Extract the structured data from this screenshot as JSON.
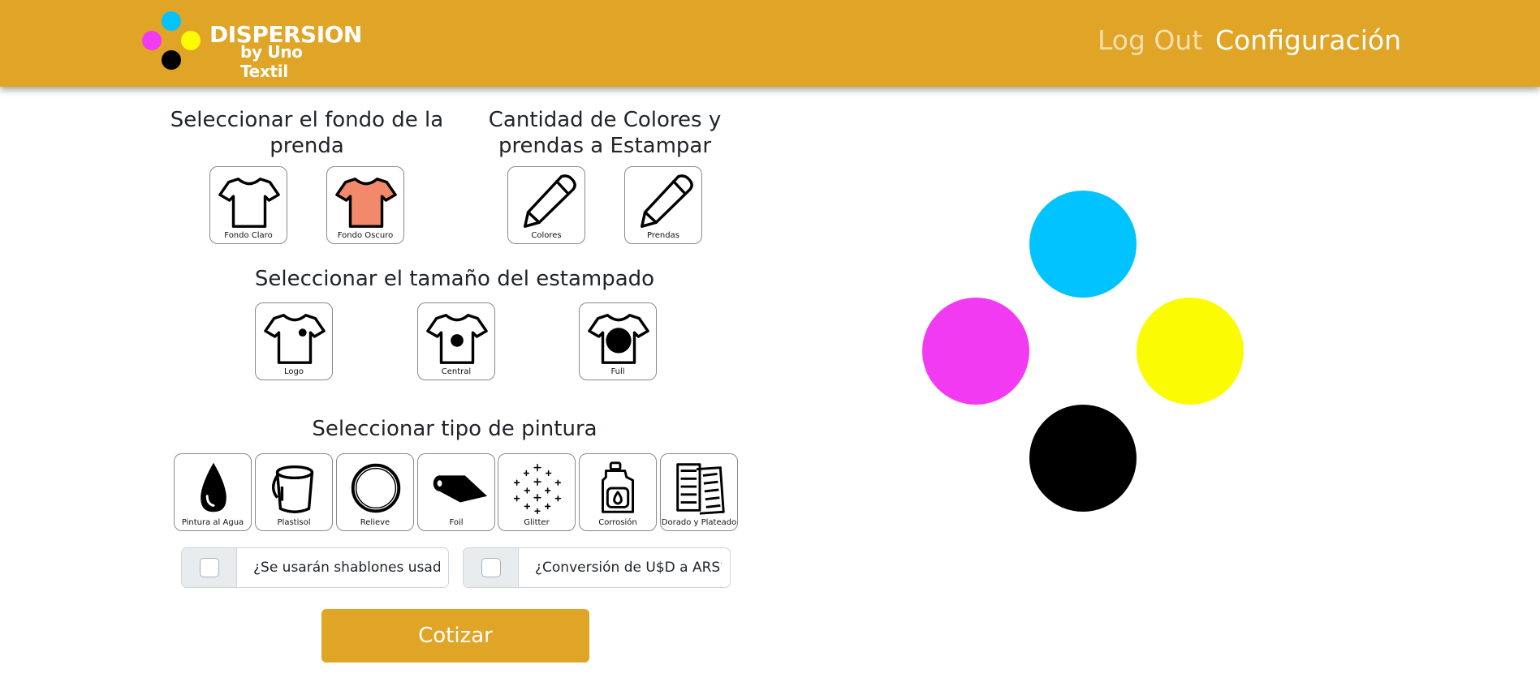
{
  "nav": {
    "brand_title": "DISPERSION",
    "brand_subtitle": "by Uno Textil",
    "logout": "Log Out",
    "config": "Configuración"
  },
  "sections": {
    "fondo_heading": "Seleccionar el fondo de la prenda",
    "cantidad_heading": "Cantidad de Colores y prendas a Estampar",
    "tamano_heading": "Seleccionar el tamaño del estampado",
    "pintura_heading": "Seleccionar tipo de pintura"
  },
  "fondo_options": [
    "Fondo Claro",
    "Fondo Oscuro"
  ],
  "cantidad_options": [
    "Colores",
    "Prendas"
  ],
  "tamano_options": [
    "Logo",
    "Central",
    "Full"
  ],
  "pintura_options": [
    "Pintura al Agua",
    "Plastisol",
    "Relieve",
    "Foil",
    "Glitter",
    "Corrosión",
    "Dorado y Plateado"
  ],
  "checks": {
    "shablones": "¿Se usarán shablones usados?",
    "conversion": "¿Conversión de U$D a ARS?"
  },
  "cotizar_label": "Cotizar",
  "colors": {
    "brand": "#e0a526",
    "cyan": "#00c3ff",
    "magenta": "#f23af2",
    "yellow": "#fbfb03",
    "black": "#000000",
    "salmon": "#f2896a"
  }
}
